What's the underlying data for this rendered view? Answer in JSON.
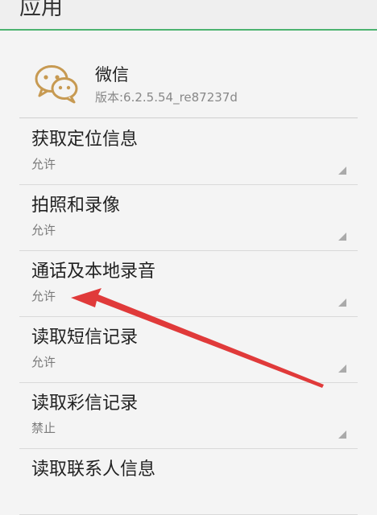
{
  "header": {
    "title": "应用"
  },
  "app": {
    "name": "微信",
    "version": "版本:6.2.5.54_re87237d",
    "icon": "wechat-icon"
  },
  "permissions": [
    {
      "title": "获取定位信息",
      "value": "允许"
    },
    {
      "title": "拍照和录像",
      "value": "允许"
    },
    {
      "title": "通话及本地录音",
      "value": "允许"
    },
    {
      "title": "读取短信记录",
      "value": "允许"
    },
    {
      "title": "读取彩信记录",
      "value": "禁止"
    },
    {
      "title": "读取联系人信息",
      "value": ""
    }
  ],
  "colors": {
    "accent_line": "#4cb36f",
    "icon_color": "#c79a52",
    "arrow": "#e03a3a"
  }
}
